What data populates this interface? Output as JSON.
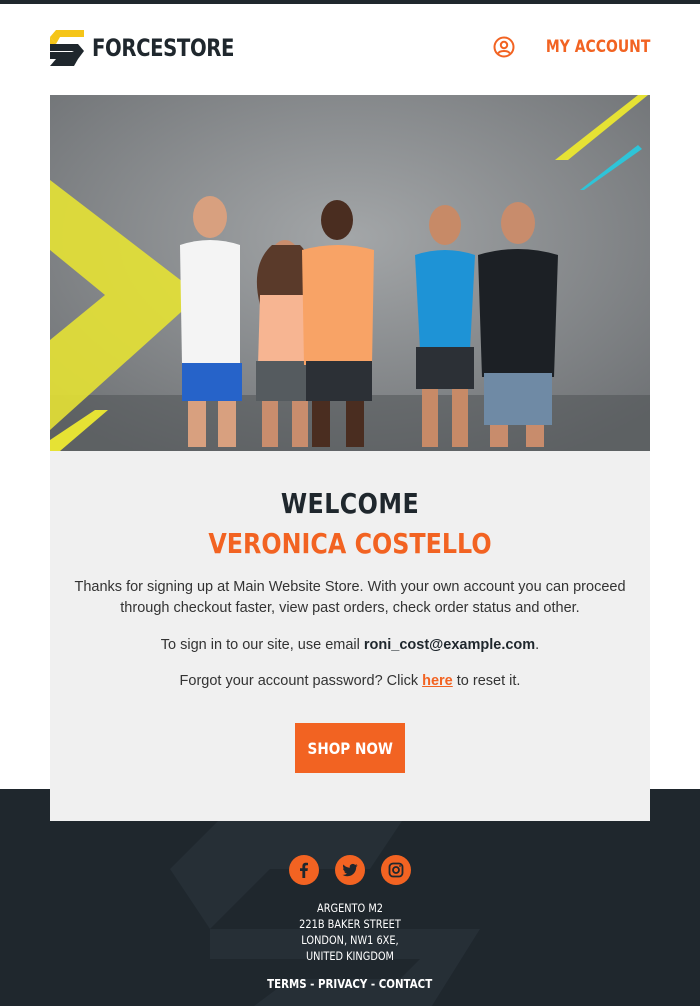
{
  "header": {
    "brand": "FORCESTORE",
    "account_label": "MY ACCOUNT"
  },
  "hero": {
    "image": "group-of-five-athletes-photo"
  },
  "content": {
    "welcome": "WELCOME",
    "customer_name": "VERONICA COSTELLO",
    "intro": "Thanks for signing up at Main Website Store. With your own account you can proceed through checkout faster, view past orders, check order status and other.",
    "signin_prefix": "To sign in to our site, use email ",
    "email": "roni_cost@example.com",
    "signin_suffix": ".",
    "forgot_prefix": "Forgot your account password? Click ",
    "forgot_link": "here",
    "forgot_suffix": " to reset it.",
    "shop_button": "SHOP NOW"
  },
  "footer": {
    "social": [
      "facebook-icon",
      "twitter-icon",
      "instagram-icon"
    ],
    "address": [
      "ARGENTO M2",
      "221B BAKER STREET",
      "LONDON, NW1 6XE,",
      "UNITED KINGDOM"
    ],
    "links": [
      "TERMS",
      "PRIVACY",
      "CONTACT"
    ],
    "separator": " - "
  },
  "colors": {
    "accent": "#f26322",
    "dark": "#1f272d",
    "panel": "#f0f0f0",
    "logo_yellow": "#f5c518"
  }
}
